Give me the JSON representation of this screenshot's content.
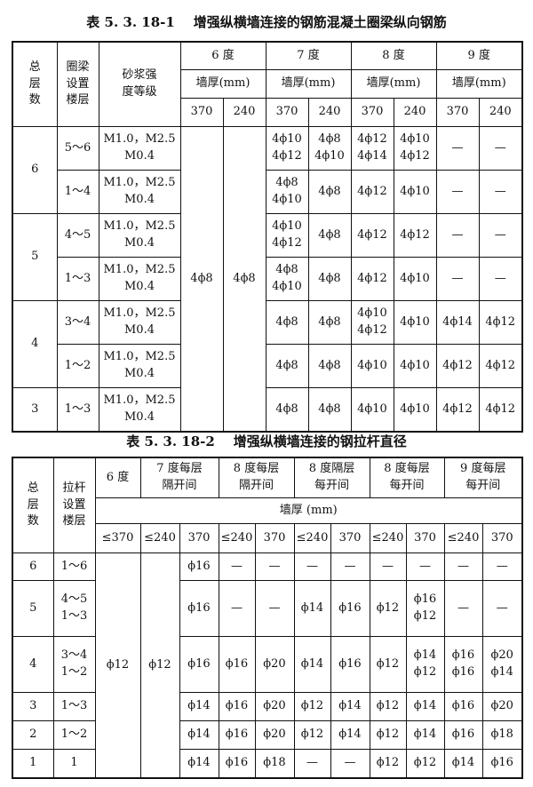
{
  "table1": {
    "caption": "表 5. 3. 18-1    增强纵横墙连接的钢筋混凝土圈梁纵向钢筋",
    "h_total": "总\n层\n数",
    "h_floor": "圈梁\n设置\n楼层",
    "h_mortar": "砂浆强\n度等级",
    "degrees": [
      "6  度",
      "7  度",
      "8  度",
      "9  度"
    ],
    "thick_label": "墙厚(mm)",
    "thick": [
      "370",
      "240",
      "370",
      "240",
      "370",
      "240",
      "370",
      "240"
    ],
    "mortar": "M1.0，M2.5\nM0.4",
    "six_deg": [
      "4ϕ8",
      "4ϕ8"
    ],
    "groups": [
      {
        "total": "6",
        "rows": [
          {
            "floor": "5～6",
            "cells": [
              "4ϕ10\n4ϕ12",
              "4ϕ8\n4ϕ10",
              "4ϕ12\n4ϕ14",
              "4ϕ10\n4ϕ12",
              "—",
              "—"
            ]
          },
          {
            "floor": "1～4",
            "cells": [
              "4ϕ8\n4ϕ10",
              "4ϕ8",
              "4ϕ12",
              "4ϕ10",
              "—",
              "—"
            ]
          }
        ]
      },
      {
        "total": "5",
        "rows": [
          {
            "floor": "4～5",
            "cells": [
              "4ϕ10\n4ϕ12",
              "4ϕ8",
              "4ϕ12",
              "4ϕ12",
              "—",
              "—"
            ]
          },
          {
            "floor": "1～3",
            "cells": [
              "4ϕ8\n4ϕ10",
              "4ϕ8",
              "4ϕ12",
              "4ϕ10",
              "—",
              "—"
            ]
          }
        ]
      },
      {
        "total": "4",
        "rows": [
          {
            "floor": "3～4",
            "cells": [
              "4ϕ8",
              "4ϕ8",
              "4ϕ10\n4ϕ12",
              "4ϕ10",
              "4ϕ14",
              "4ϕ12"
            ]
          },
          {
            "floor": "1～2",
            "cells": [
              "4ϕ8",
              "4ϕ8",
              "4ϕ10",
              "4ϕ10",
              "4ϕ12",
              "4ϕ12"
            ]
          }
        ]
      },
      {
        "total": "3",
        "rows": [
          {
            "floor": "1～3",
            "cells": [
              "4ϕ8",
              "4ϕ8",
              "4ϕ10",
              "4ϕ10",
              "4ϕ12",
              "4ϕ12"
            ]
          }
        ]
      }
    ]
  },
  "table2": {
    "caption": "表 5. 3. 18-2    增强纵横墙连接的钢拉杆直径",
    "h_total": "总\n层\n数",
    "h_floor": "拉杆\n设置\n楼层",
    "h_6": "6 度",
    "h_groups": [
      "7 度每层\n隔开间",
      "8 度每层\n隔开间",
      "8 度隔层\n每开间",
      "8 度每层\n每开间",
      "9 度每层\n每开间"
    ],
    "thick_label": "墙厚  (mm)",
    "thick": [
      "≤370",
      "≤240",
      "370",
      "≤240",
      "370",
      "≤240",
      "370",
      "≤240",
      "370",
      "≤240",
      "370"
    ],
    "merged": [
      "ϕ12",
      "ϕ12"
    ],
    "rows": [
      {
        "total": "6",
        "floor": "1～6",
        "cells": [
          "ϕ16",
          "—",
          "—",
          "—",
          "—",
          "—",
          "—",
          "—",
          "—"
        ]
      },
      {
        "total": "5",
        "floor": "4～5\n1～3",
        "cells": [
          "ϕ16",
          "—",
          "—",
          "ϕ14",
          "ϕ16",
          "ϕ12",
          "ϕ16\nϕ12",
          "—",
          "—"
        ]
      },
      {
        "total": "4",
        "floor": "3～4\n1～2",
        "cells": [
          "ϕ16",
          "ϕ16",
          "ϕ20",
          "ϕ14",
          "ϕ16",
          "ϕ12",
          "ϕ14\nϕ12",
          "ϕ16\nϕ16",
          "ϕ20\nϕ14"
        ]
      },
      {
        "total": "3",
        "floor": "1～3",
        "cells": [
          "ϕ14",
          "ϕ16",
          "ϕ20",
          "ϕ12",
          "ϕ14",
          "ϕ12",
          "ϕ14",
          "ϕ16",
          "ϕ20"
        ]
      },
      {
        "total": "2",
        "floor": "1～2",
        "cells": [
          "ϕ14",
          "ϕ16",
          "ϕ20",
          "ϕ12",
          "ϕ14",
          "ϕ12",
          "ϕ14",
          "ϕ16",
          "ϕ18"
        ]
      },
      {
        "total": "1",
        "floor": "1",
        "cells": [
          "ϕ14",
          "ϕ16",
          "ϕ18",
          "—",
          "—",
          "ϕ12",
          "ϕ12",
          "ϕ14",
          "ϕ16"
        ]
      }
    ]
  }
}
